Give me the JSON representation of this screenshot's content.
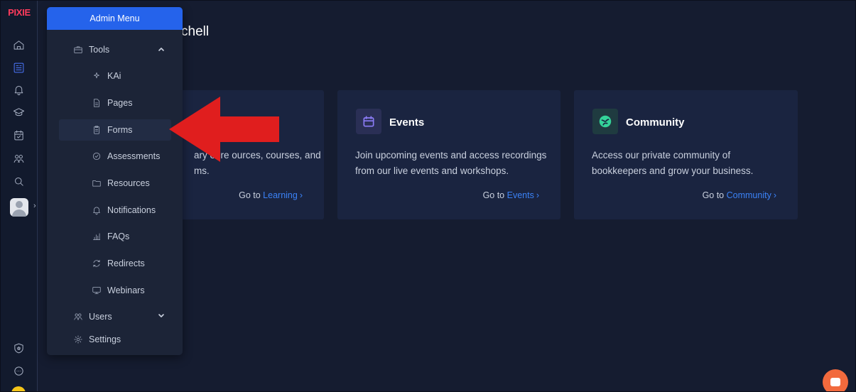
{
  "brand": {
    "logo_text": "PIXIE",
    "accent_color": "#2563eb",
    "brand_color": "#ff3b5c"
  },
  "greeting": {
    "text": "chell"
  },
  "rail": {
    "icons": [
      "home-icon",
      "dashboard-icon",
      "bell-icon",
      "graduation-cap-icon",
      "calendar-check-icon",
      "community-icon",
      "search-icon",
      "avatar",
      "shield-star-icon",
      "chat-icon"
    ]
  },
  "admin_menu": {
    "title": "Admin Menu",
    "tools_label": "Tools",
    "tools_items": [
      {
        "label": "KAi",
        "icon": "sparkle-icon"
      },
      {
        "label": "Pages",
        "icon": "page-icon"
      },
      {
        "label": "Forms",
        "icon": "form-icon"
      },
      {
        "label": "Assessments",
        "icon": "check-circle-icon"
      },
      {
        "label": "Resources",
        "icon": "folder-icon"
      },
      {
        "label": "Notifications",
        "icon": "bell-icon"
      },
      {
        "label": "FAQs",
        "icon": "bar-chart-icon"
      },
      {
        "label": "Redirects",
        "icon": "refresh-icon"
      },
      {
        "label": "Webinars",
        "icon": "monitor-icon"
      }
    ],
    "users_label": "Users",
    "settings_label": "Settings"
  },
  "cards": [
    {
      "title": "",
      "desc_line1": "ary of re  ources, courses, and",
      "desc_line2": "ms.",
      "link_prefix": "Go to ",
      "link_target": "Learning"
    },
    {
      "title": "Events",
      "desc_line1": "Join upcoming events and access recordings",
      "desc_line2": "from our live events and workshops.",
      "link_prefix": "Go to ",
      "link_target": "Events",
      "icon_color": "#7c6bf0"
    },
    {
      "title": "Community",
      "desc_line1": "Access our private community of",
      "desc_line2": "bookkeepers and grow your business.",
      "link_prefix": "Go to ",
      "link_target": "Community",
      "icon_color": "#34d399"
    }
  ],
  "annotation": {
    "arrow_color": "#e01e1e"
  }
}
